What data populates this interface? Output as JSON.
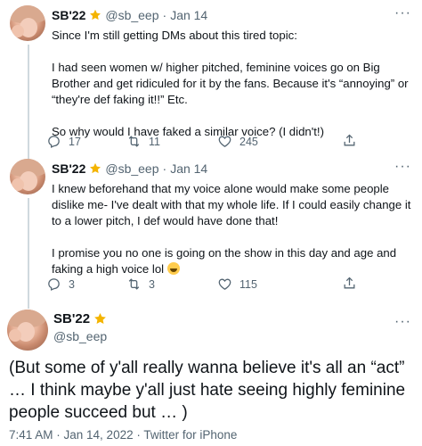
{
  "colors": {
    "text_primary": "#0f1419",
    "text_secondary": "#536471",
    "badge": "#f4b400",
    "thread_line": "#cfd9de"
  },
  "tweets": [
    {
      "display_name": "SB'22",
      "badge_icon": "star-badge-icon",
      "handle": "@sb_eep",
      "separator": "·",
      "date": "Jan 14",
      "paragraphs": [
        "Since I'm still getting DMs about this tired topic:",
        "I had seen women w/ higher pitched, feminine voices go on Big Brother and get ridiculed for it by the fans. Because it's “annoying” or “they're def faking it!!” Etc.",
        "So why would I have faked a similar voice? (I didn't!)"
      ],
      "actions": {
        "replies": "17",
        "retweets": "11",
        "likes": "245"
      }
    },
    {
      "display_name": "SB'22",
      "badge_icon": "star-badge-icon",
      "handle": "@sb_eep",
      "separator": "·",
      "date": "Jan 14",
      "paragraphs": [
        "I knew beforehand that my voice alone would make some people dislike me- I've dealt with that my whole life. If I could easily change it to a lower pitch, I def would have done that!",
        "I promise you no one is going on the show in this day and age and faking a high voice lol"
      ],
      "emoji_icon": "grinning-sweat-emoji-icon",
      "actions": {
        "replies": "3",
        "retweets": "3",
        "likes": "115"
      }
    }
  ],
  "main_tweet": {
    "display_name": "SB'22",
    "badge_icon": "star-badge-icon",
    "handle": "@sb_eep",
    "text": "(But some of y'all really wanna believe it's all an “act” … I think maybe y'all just hate seeing highly feminine people succeed but … )",
    "meta": "7:41 AM · Jan 14, 2022 · Twitter for iPhone"
  }
}
